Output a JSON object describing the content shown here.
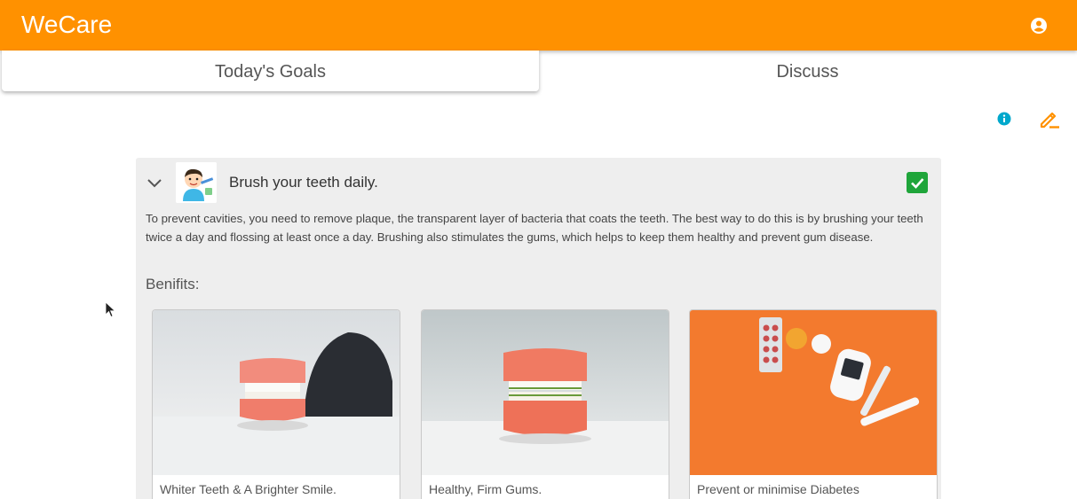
{
  "app": {
    "title": "WeCare",
    "accent": "#ff9100"
  },
  "tabs": [
    {
      "label": "Today's Goals",
      "active": true
    },
    {
      "label": "Discuss",
      "active": false
    }
  ],
  "toolbar": {
    "info_icon": "info-icon",
    "edit_icon": "edit-icon"
  },
  "goal": {
    "title": "Brush your teeth daily.",
    "checked": true,
    "description": "To prevent cavities, you need to remove plaque, the transparent layer of bacteria that coats the teeth. The best way to do this is by brushing your teeth twice a day and flossing at least once a day. Brushing also stimulates the gums, which helps to keep them healthy and prevent gum disease.",
    "benefits_label": "Benifits:",
    "benefits": [
      {
        "caption": "Whiter Teeth & A Brighter Smile."
      },
      {
        "caption": "Healthy, Firm Gums."
      },
      {
        "caption": "Prevent or minimise Diabetes"
      }
    ]
  }
}
